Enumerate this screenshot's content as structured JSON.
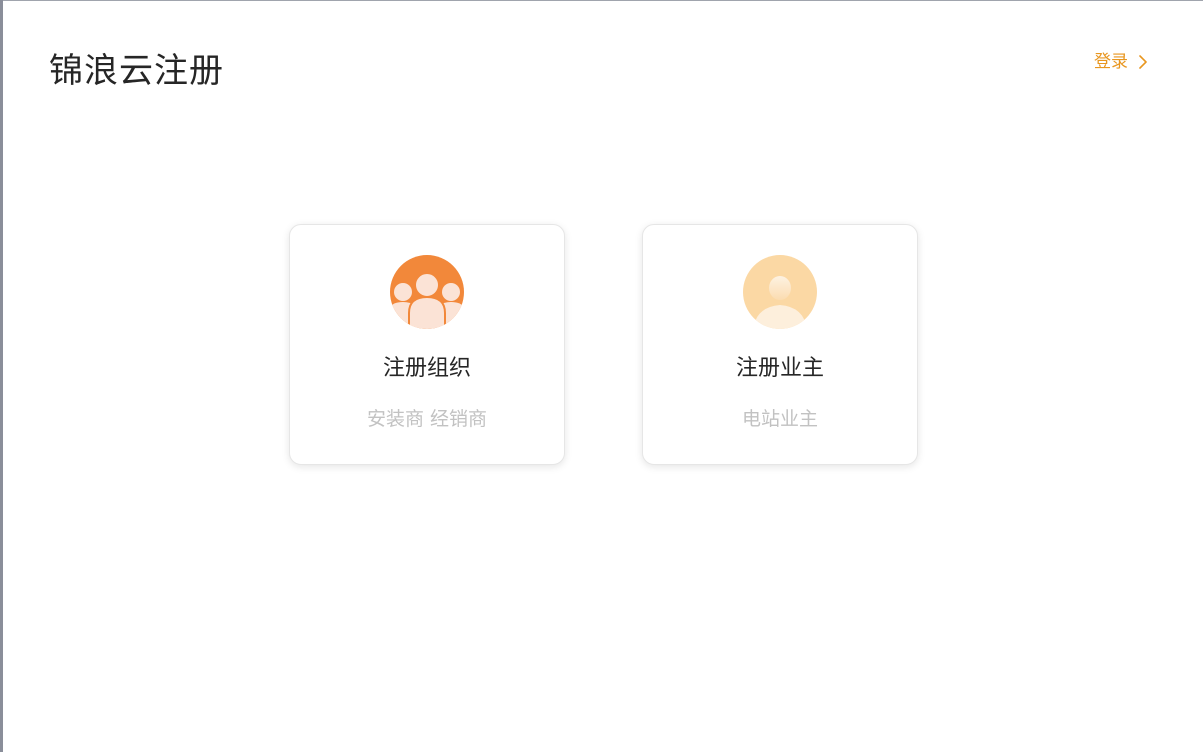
{
  "header": {
    "title": "锦浪云注册",
    "login_label": "登录"
  },
  "cards": [
    {
      "title": "注册组织",
      "subtitle": "安装商 经销商",
      "icon": "group-users-icon"
    },
    {
      "title": "注册业主",
      "subtitle": "电站业主",
      "icon": "single-user-icon"
    }
  ],
  "colors": {
    "accent": "#e8961f",
    "org_avatar_bg": "#f2883a",
    "owner_avatar_bg": "#fbd8a4",
    "title_text": "#262626",
    "subtitle_text": "#c2c2c2"
  }
}
